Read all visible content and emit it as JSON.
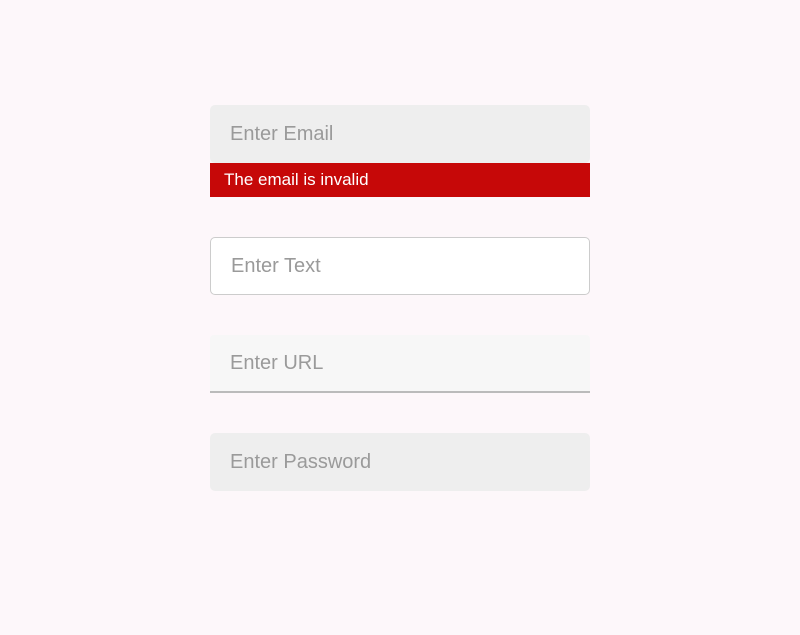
{
  "fields": {
    "email": {
      "placeholder": "Enter Email",
      "error": "The email is invalid"
    },
    "text": {
      "placeholder": "Enter Text"
    },
    "url": {
      "placeholder": "Enter URL"
    },
    "password": {
      "placeholder": "Enter Password"
    }
  }
}
